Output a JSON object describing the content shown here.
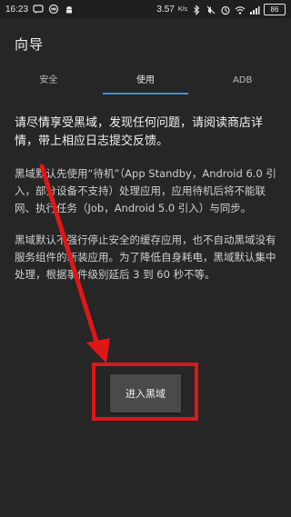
{
  "status_bar": {
    "time": "16:23",
    "network_speed": "3.57",
    "network_speed_unit": "K/s",
    "battery": "86",
    "icons": [
      "message-icon",
      "infinity-icon",
      "android-icon",
      "bluetooth-icon",
      "mute-icon",
      "alarm-icon",
      "wifi-icon",
      "signal-icon"
    ]
  },
  "header": {
    "title": "向导"
  },
  "tabs": [
    {
      "label": "安全",
      "active": false
    },
    {
      "label": "使用",
      "active": true
    },
    {
      "label": "ADB",
      "active": false
    }
  ],
  "content": {
    "intro": "请尽情享受黑域，发现任何问题，请阅读商店详情，带上相应日志提交反馈。",
    "standby": "黑域默认先使用“待机”（App Standby，Android 6.0 引入，部分设备不支持）处理应用，应用待机后将不能联网、执行任务（Job，Android 5.0 引入）与同步。",
    "cache": "黑域默认不强行停止安全的缓存应用，也不自动黑域没有服务组件的新装应用。为了降低自身耗电，黑域默认集中处理，根据事件级别延后 3 到 60 秒不等。"
  },
  "action": {
    "enter_label": "进入黑域"
  },
  "colors": {
    "background": "#262626",
    "accent": "#4a8fd8",
    "annotation": "#e01616",
    "button": "#4a4a4a"
  }
}
